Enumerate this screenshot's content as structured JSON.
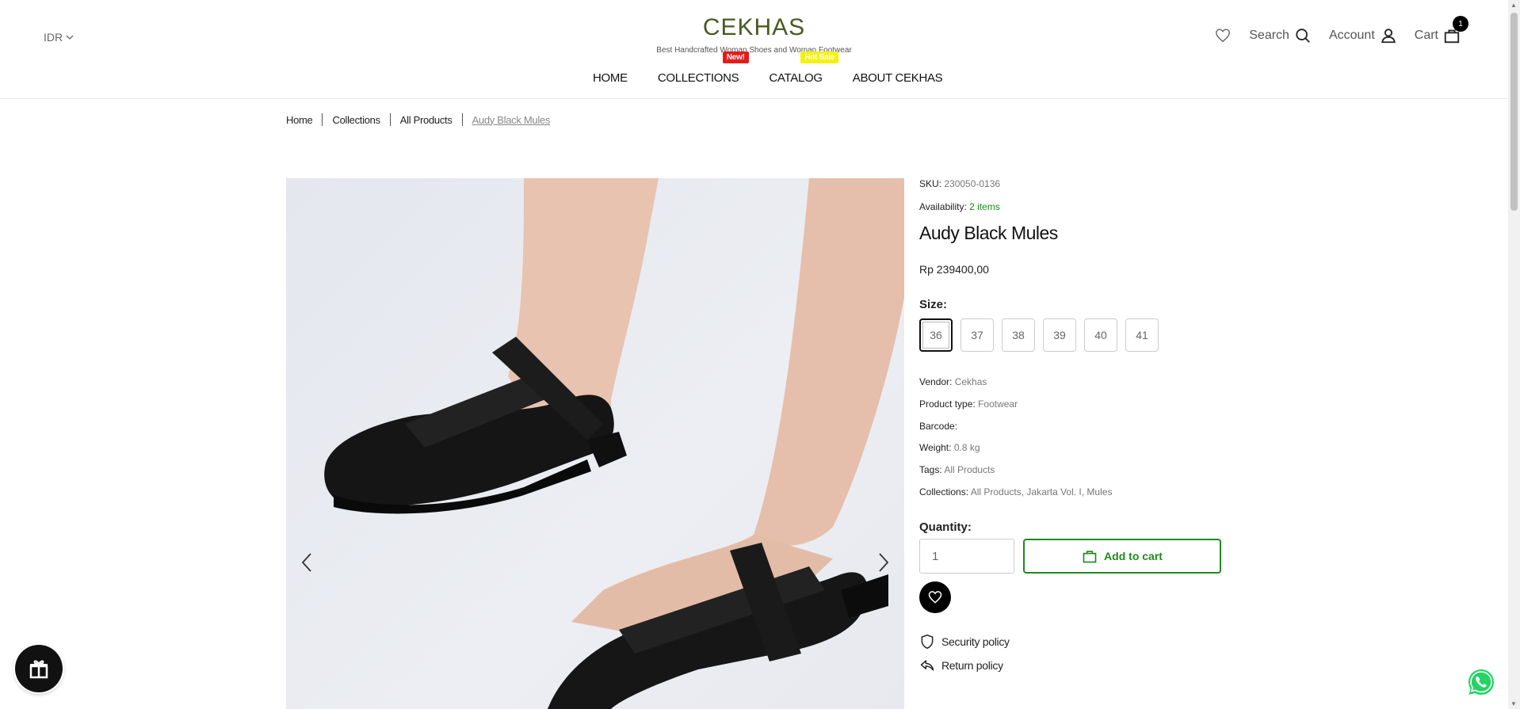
{
  "header": {
    "currency": "IDR",
    "logo": "CEKHAS",
    "tagline": "Best Handcrafted Woman Shoes and Woman Footwear",
    "nav": [
      {
        "label": "HOME"
      },
      {
        "label": "COLLECTIONS",
        "badge": "New!"
      },
      {
        "label": "CATALOG",
        "badge": "Hot Sale"
      },
      {
        "label": "ABOUT CEKHAS"
      }
    ],
    "search_label": "Search",
    "account_label": "Account",
    "cart_label": "Cart",
    "cart_count": "1"
  },
  "breadcrumb": [
    "Home",
    "Collections",
    "All Products",
    "Audy Black Mules"
  ],
  "product": {
    "sku_label": "SKU:",
    "sku": "230050-0136",
    "availability_label": "Availability:",
    "availability": "2 items",
    "title": "Audy Black Mules",
    "price": "Rp 239400,00",
    "size_label": "Size:",
    "sizes": [
      "36",
      "37",
      "38",
      "39",
      "40",
      "41"
    ],
    "selected_size": "36",
    "vendor_label": "Vendor:",
    "vendor": "Cekhas",
    "type_label": "Product type:",
    "type": "Footwear",
    "barcode_label": "Barcode:",
    "weight_label": "Weight:",
    "weight": "0.8 kg",
    "tags_label": "Tags:",
    "tags": "All Products",
    "collections_label": "Collections:",
    "collections": "All Products, Jakarta Vol. I, Mules",
    "quantity_label": "Quantity:",
    "quantity": "1",
    "add_to_cart": "Add to cart",
    "security_policy": "Security policy",
    "return_policy": "Return policy"
  },
  "colors": {
    "brand": "#4a5a22",
    "accent_green": "#1f8a1f",
    "badge_new": "#e51b1b",
    "badge_hot": "#f4f20f"
  },
  "icons": [
    "chevron-down-icon",
    "heart-icon",
    "search-icon",
    "user-icon",
    "bag-icon",
    "chevron-left-icon",
    "chevron-right-icon",
    "shield-icon",
    "return-icon",
    "gift-icon",
    "whatsapp-icon"
  ]
}
